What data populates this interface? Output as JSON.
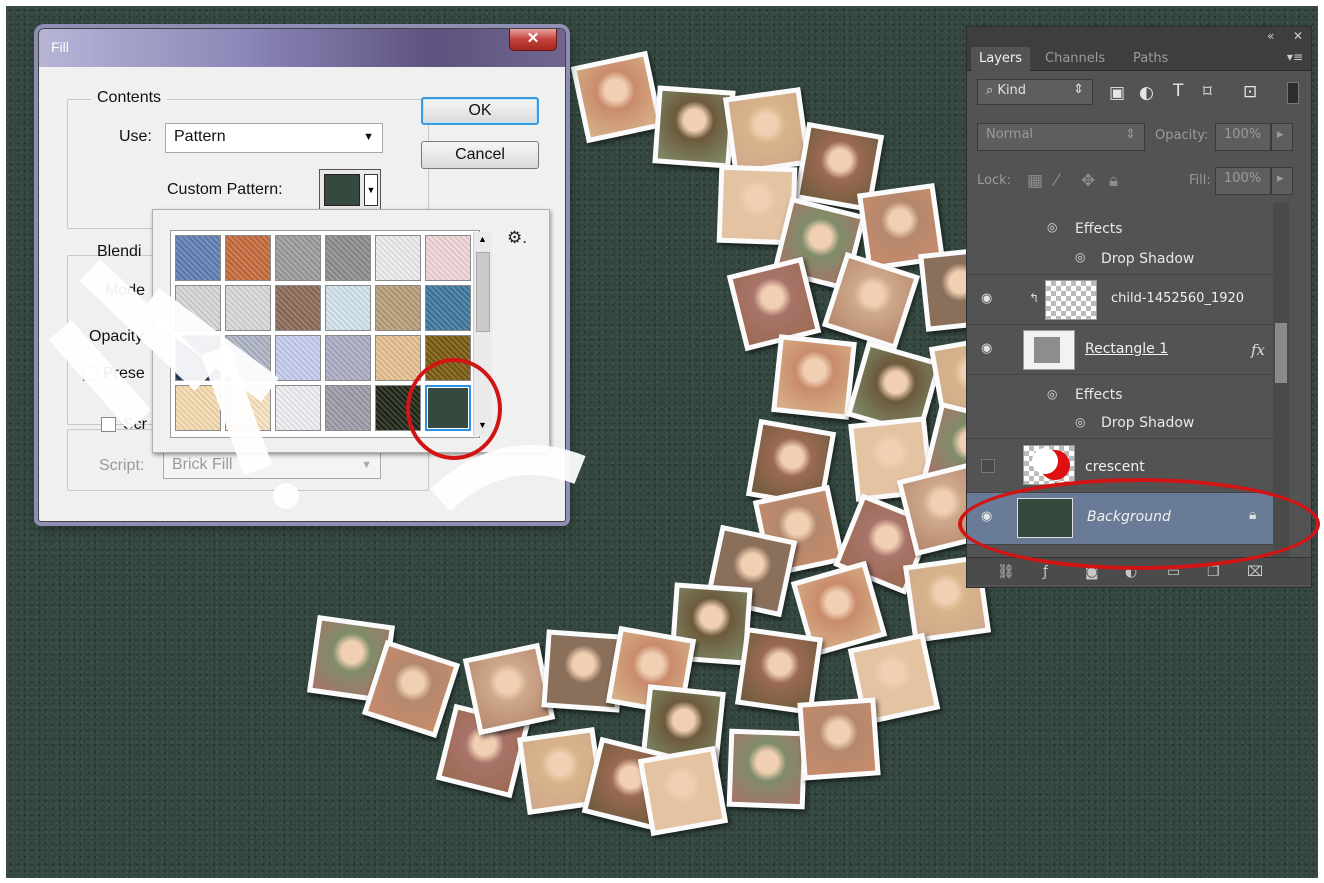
{
  "fill_dialog": {
    "title": "Fill",
    "close_label": "✕",
    "contents_legend": "Contents",
    "use_label": "Use:",
    "use_value": "Pattern",
    "custom_pattern_label": "Custom Pattern:",
    "ok_label": "OK",
    "cancel_label": "Cancel",
    "blending_legend": "Blendi",
    "mode_label": "Mode",
    "opacity_label": "Opacity",
    "preserve_label": "Prese",
    "script_label": "Scr",
    "script_field_label": "Script:",
    "script_value": "Brick Fill"
  },
  "pattern_picker": {
    "gear_icon": "gear-icon",
    "swatch_colors": [
      [
        "#5f7fb3",
        "#c86a3c",
        "#9c9c9c",
        "#8d8d8d",
        "#ececec",
        "#f1d6d8"
      ],
      [
        "#d6d6d6",
        "#d9d9d9",
        "#8b6b58",
        "#d2e4ee",
        "#b79f78",
        "#3e77a0"
      ],
      [
        "#1e3559",
        "#aeb4c4",
        "#c5cdf0",
        "#adadc6",
        "#e8c091",
        "#7a5a11"
      ],
      [
        "#f6dcb0",
        "#f9e4c2",
        "#efeff4",
        "#9c9ca8",
        "#1e2616",
        "#35493f"
      ]
    ]
  },
  "layers_panel": {
    "tabs": [
      "Layers",
      "Channels",
      "Paths"
    ],
    "kind_label": "Kind",
    "blend_mode": "Normal",
    "opacity_label": "Opacity:",
    "opacity_value": "100%",
    "lock_label": "Lock:",
    "fill_label": "Fill:",
    "fill_value": "100%",
    "rows": {
      "effects_1": "Effects",
      "drop_shadow_1": "Drop Shadow",
      "layer_child": "child-1452560_1920",
      "layer_rectangle": "Rectangle 1",
      "fx_label": "fx",
      "effects_2": "Effects",
      "drop_shadow_2": "Drop Shadow",
      "layer_crescent": "crescent",
      "layer_background": "Background"
    }
  },
  "colors": {
    "canvas": "#33473f",
    "annotation_ring": "#d21414",
    "selected_swatch": "#35493f",
    "panel_bg": "#535353"
  }
}
